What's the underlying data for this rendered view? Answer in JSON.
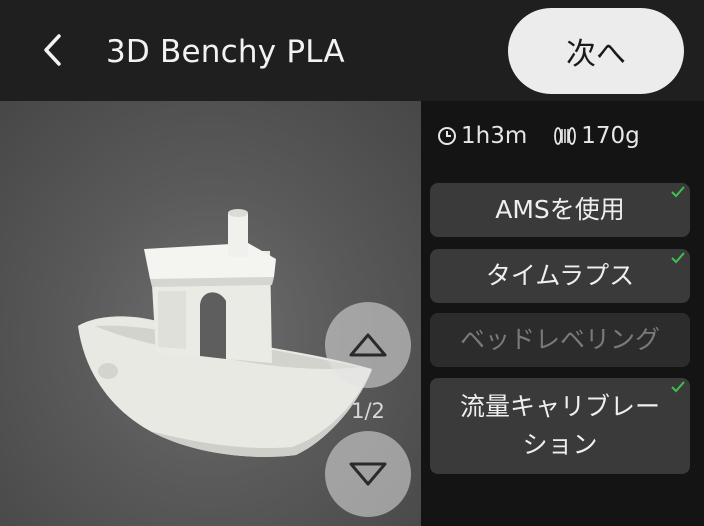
{
  "header": {
    "title": "3D Benchy PLA",
    "next_label": "次へ"
  },
  "preview": {
    "page_indicator": "1/2"
  },
  "stats": {
    "time": "1h3m",
    "filament": "170g"
  },
  "options": [
    {
      "label": "AMSを使用",
      "checked": true,
      "enabled": true
    },
    {
      "label": "タイムラプス",
      "checked": true,
      "enabled": true
    },
    {
      "label": "ベッドレベリング",
      "checked": false,
      "enabled": false
    },
    {
      "label": "流量キャリブレーション",
      "checked": true,
      "enabled": true
    }
  ],
  "colors": {
    "check": "#3fbf4f",
    "button_bg": "#ececec",
    "panel_bg": "#141414",
    "option_bg": "#3a3a3a"
  }
}
